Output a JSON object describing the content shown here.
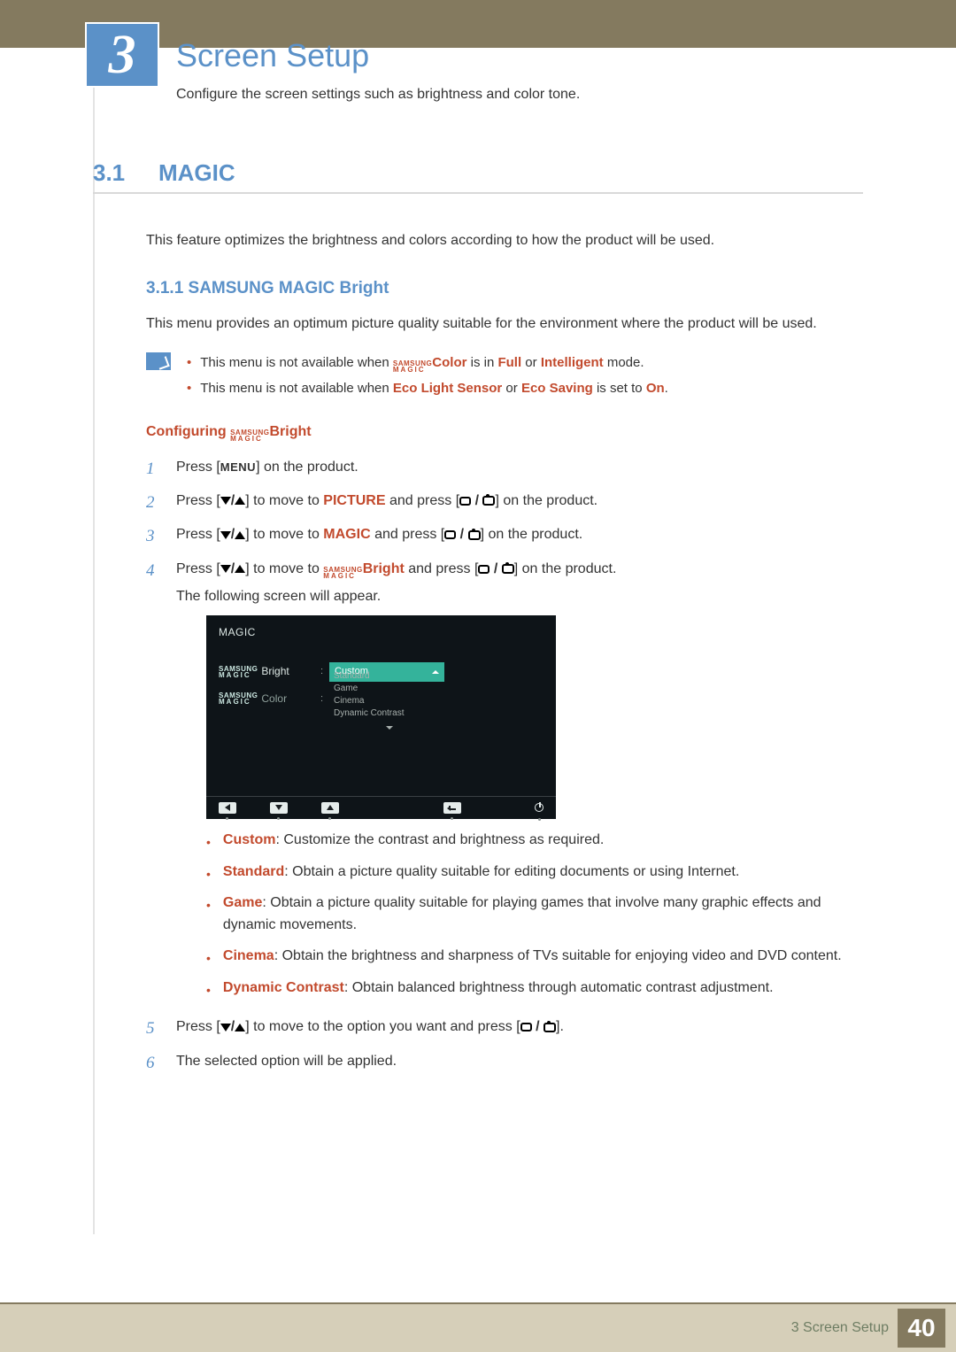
{
  "chapter_number": "3",
  "page_title": "Screen Setup",
  "intro_text": "Configure the screen settings such as brightness and color tone.",
  "section": {
    "num": "3.1",
    "title": "MAGIC"
  },
  "section_para": "This feature optimizes the brightness and colors according to how the product will be used.",
  "subsection": "3.1.1   SAMSUNG MAGIC Bright",
  "subsection_para": "This menu provides an optimum picture quality suitable for the environment where the product will be used.",
  "notes": {
    "n1_a": "This menu is not available when ",
    "n1_b": "Color",
    "n1_c": " is in ",
    "n1_d": "Full",
    "n1_e": " or ",
    "n1_f": "Intelligent",
    "n1_g": " mode.",
    "n2_a": "This menu is not available when ",
    "n2_b": "Eco Light Sensor",
    "n2_c": " or ",
    "n2_d": "Eco Saving",
    "n2_e": " is set to ",
    "n2_f": "On",
    "n2_g": "."
  },
  "config_title_a": "Configuring ",
  "config_title_b": "Bright",
  "magic_small_top": "SAMSUNG",
  "magic_small_bot": "MAGIC",
  "steps": {
    "s1_a": "Press [",
    "s1_menu": "MENU",
    "s1_b": "] on the product.",
    "s2_a": "Press [",
    "s2_b": "] to move to ",
    "s2_c": "PICTURE",
    "s2_d": " and press [",
    "s2_e": "] on the product.",
    "s3_a": "Press [",
    "s3_b": "] to move to ",
    "s3_c": "MAGIC",
    "s3_d": " and press [",
    "s3_e": "] on the product.",
    "s4_a": "Press [",
    "s4_b": "] to move to ",
    "s4_c": "Bright",
    "s4_d": " and press [",
    "s4_e": "] on the product.",
    "s4_note": "The following screen will appear.",
    "s5_a": "Press [",
    "s5_b": "] to move to the option you want and press [",
    "s5_c": "].",
    "s6": "The selected option will be applied."
  },
  "osd": {
    "title": "MAGIC",
    "row1_label": "Bright",
    "row1_selected": "Custom",
    "row2_label": "Color",
    "options": [
      "Standard",
      "Game",
      "Cinema",
      "Dynamic Contrast"
    ]
  },
  "bullets": {
    "b1_t": "Custom",
    "b1": ": Customize the contrast and brightness as required.",
    "b2_t": "Standard",
    "b2": ": Obtain a picture quality suitable for editing documents or using Internet.",
    "b3_t": "Game",
    "b3": ": Obtain a picture quality suitable for playing games that involve many graphic effects and dynamic movements.",
    "b4_t": "Cinema",
    "b4": ": Obtain the brightness and sharpness of TVs suitable for enjoying video and DVD content.",
    "b5_t": "Dynamic Contrast",
    "b5": ": Obtain balanced brightness through automatic contrast adjustment."
  },
  "footer": {
    "text": "3 Screen Setup",
    "page": "40"
  }
}
